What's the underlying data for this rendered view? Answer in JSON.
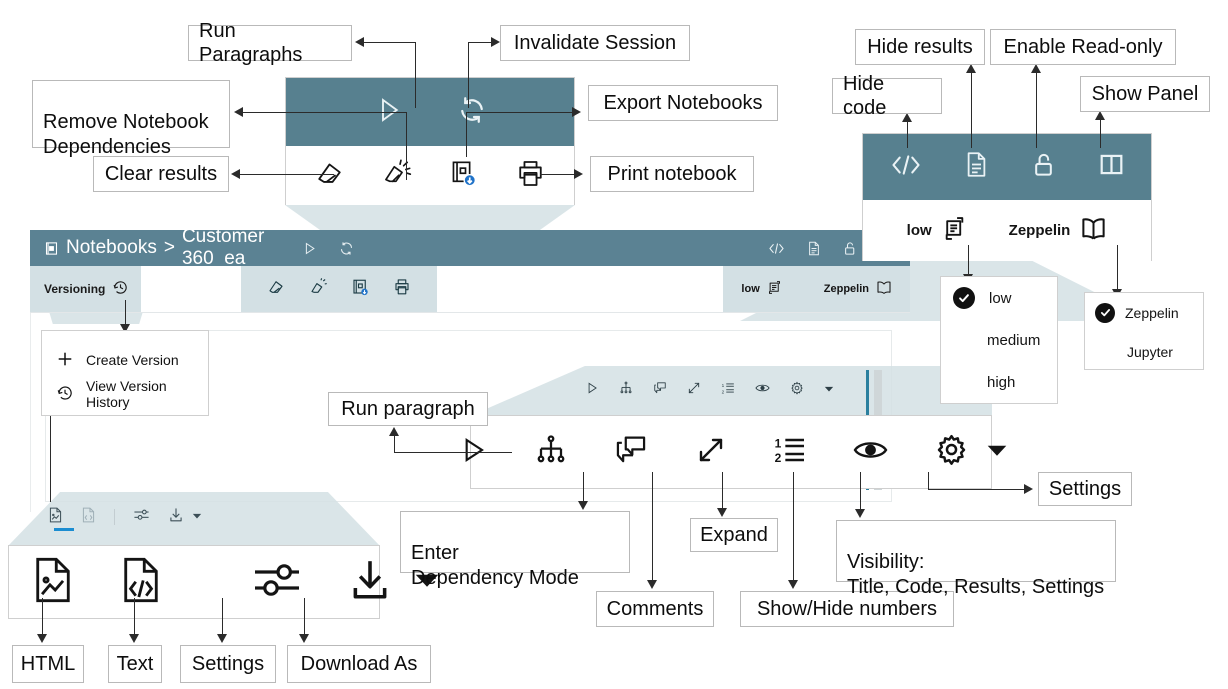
{
  "app": {
    "breadcrumb_root": "Notebooks",
    "breadcrumb_sep": ">",
    "notebook_name": "Customer 360_ea",
    "versioning_label": "Versioning",
    "interpreter_value": "low",
    "notebook_format_value": "Zeppelin"
  },
  "callouts": {
    "run_paragraphs": "Run Paragraphs",
    "invalidate_session": "Invalidate Session",
    "remove_notebook_dependencies": "Remove Notebook\nDependencies",
    "export_notebooks": "Export Notebooks",
    "clear_results": "Clear results",
    "print_notebook": "Print notebook",
    "hide_code": "Hide code",
    "hide_results": "Hide results",
    "enable_read_only": "Enable Read-only",
    "show_panel": "Show Panel",
    "run_paragraph": "Run paragraph",
    "enter_dependency_mode": "Enter\nDependency Mode",
    "comments": "Comments",
    "expand": "Expand",
    "show_hide_numbers": "Show/Hide numbers",
    "visibility": "Visibility:\nTitle, Code, Results, Settings",
    "settings": "Settings",
    "html": "HTML",
    "text": "Text",
    "settings_tab": "Settings",
    "download_as": "Download As"
  },
  "version_menu": {
    "items": [
      {
        "label": "Create Version",
        "icon": "plus-icon"
      },
      {
        "label": "View Version History",
        "icon": "history-clock-icon"
      }
    ]
  },
  "interpreter_menu": {
    "items": [
      {
        "label": "low",
        "selected": true
      },
      {
        "label": "medium",
        "selected": false
      },
      {
        "label": "high",
        "selected": false
      }
    ]
  },
  "format_menu": {
    "items": [
      {
        "label": "Zeppelin",
        "selected": true
      },
      {
        "label": "Jupyter",
        "selected": false
      }
    ]
  },
  "toolbars": {
    "notebook_main": [
      {
        "name": "run-paragraphs-icon",
        "label": "Run Paragraphs"
      },
      {
        "name": "invalidate-session-icon",
        "label": "Invalidate Session"
      },
      {
        "name": "clear-results-icon",
        "label": "Clear results"
      },
      {
        "name": "remove-dependencies-icon",
        "label": "Remove Notebook Dependencies"
      },
      {
        "name": "export-notebooks-icon",
        "label": "Export Notebooks"
      },
      {
        "name": "print-notebook-icon",
        "label": "Print notebook"
      }
    ],
    "notebook_right": [
      {
        "name": "hide-code-icon",
        "label": "Hide code"
      },
      {
        "name": "hide-results-icon",
        "label": "Hide results"
      },
      {
        "name": "enable-read-only-icon",
        "label": "Enable Read-only"
      },
      {
        "name": "show-panel-icon",
        "label": "Show Panel"
      }
    ],
    "paragraph": [
      {
        "name": "run-paragraph-icon",
        "label": "Run paragraph"
      },
      {
        "name": "dependency-mode-icon",
        "label": "Enter Dependency Mode"
      },
      {
        "name": "comments-icon",
        "label": "Comments"
      },
      {
        "name": "expand-icon",
        "label": "Expand"
      },
      {
        "name": "show-hide-numbers-icon",
        "label": "Show/Hide numbers"
      },
      {
        "name": "visibility-icon",
        "label": "Visibility"
      },
      {
        "name": "settings-gear-icon",
        "label": "Settings"
      }
    ],
    "result_tabs": [
      {
        "name": "html-view-icon",
        "label": "HTML"
      },
      {
        "name": "text-view-icon",
        "label": "Text"
      },
      {
        "name": "settings-sliders-icon",
        "label": "Settings"
      },
      {
        "name": "download-as-icon",
        "label": "Download As"
      }
    ]
  },
  "colors": {
    "header_teal": "#5b8293",
    "panel_tint": "#d3e0e4",
    "accent_blue": "#1b8dd1",
    "badge_blue": "#1f72c8",
    "label_border": "#b9b9b9"
  }
}
